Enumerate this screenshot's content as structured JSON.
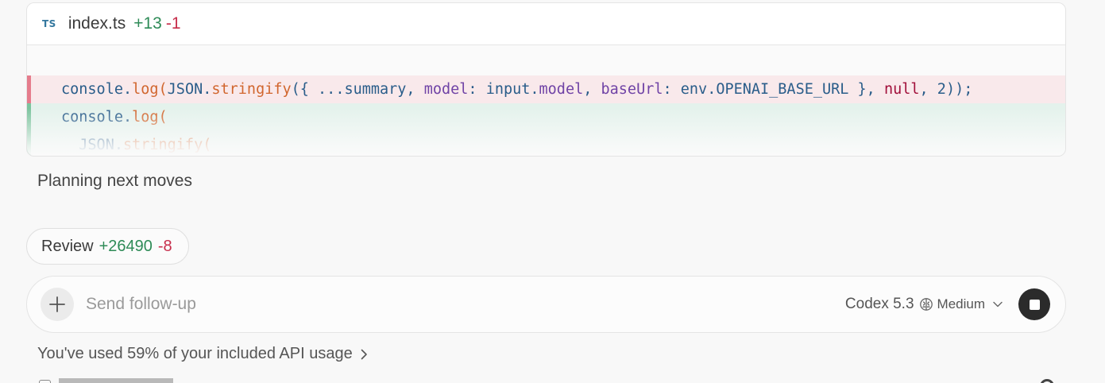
{
  "diff": {
    "file_badge": "TS",
    "file_name": "index.ts",
    "additions": "+13",
    "deletions": "-1",
    "lines": [
      {
        "kind": "removed",
        "tokens": [
          {
            "t": "console",
            "c": "tok-id"
          },
          {
            "t": ".",
            "c": "tok-punct"
          },
          {
            "t": "log",
            "c": "tok-fn"
          },
          {
            "t": "(",
            "c": "tok-fn"
          },
          {
            "t": "JSON",
            "c": "tok-id"
          },
          {
            "t": ".",
            "c": "tok-punct"
          },
          {
            "t": "stringify",
            "c": "tok-fn"
          },
          {
            "t": "({ ...",
            "c": "tok-punct"
          },
          {
            "t": "summary",
            "c": "tok-id"
          },
          {
            "t": ", ",
            "c": "tok-punct"
          },
          {
            "t": "model",
            "c": "tok-prop"
          },
          {
            "t": ": ",
            "c": "tok-punct"
          },
          {
            "t": "input",
            "c": "tok-id"
          },
          {
            "t": ".",
            "c": "tok-punct"
          },
          {
            "t": "model",
            "c": "tok-prop"
          },
          {
            "t": ", ",
            "c": "tok-punct"
          },
          {
            "t": "baseUrl",
            "c": "tok-prop"
          },
          {
            "t": ": ",
            "c": "tok-punct"
          },
          {
            "t": "env",
            "c": "tok-id"
          },
          {
            "t": ".",
            "c": "tok-punct"
          },
          {
            "t": "OPENAI_BASE_URL",
            "c": "tok-id"
          },
          {
            "t": " }, ",
            "c": "tok-punct"
          },
          {
            "t": "null",
            "c": "tok-kw"
          },
          {
            "t": ", 2));",
            "c": "tok-punct"
          }
        ]
      },
      {
        "kind": "added",
        "tokens": [
          {
            "t": "console",
            "c": "tok-id"
          },
          {
            "t": ".",
            "c": "tok-punct"
          },
          {
            "t": "log",
            "c": "tok-fn"
          },
          {
            "t": "(",
            "c": "tok-fn"
          }
        ]
      },
      {
        "kind": "added",
        "tokens": [
          {
            "t": "  JSON",
            "c": "tok-id"
          },
          {
            "t": ".",
            "c": "tok-punct"
          },
          {
            "t": "stringify",
            "c": "tok-fn"
          },
          {
            "t": "(",
            "c": "tok-fn"
          }
        ]
      }
    ]
  },
  "status": "Planning next moves",
  "review": {
    "label": "Review",
    "additions": "+26490",
    "deletions": "-8"
  },
  "composer": {
    "placeholder": "Send follow-up",
    "model": "Codex 5.3",
    "effort": "Medium"
  },
  "usage": {
    "text": "You've used 59% of your included API usage"
  },
  "icons": {
    "add": "plus-icon",
    "effort": "brain-icon",
    "dropdown": "chevron-down-icon",
    "stop": "stop-icon",
    "usage_link": "chevron-right-icon"
  },
  "colors": {
    "added": "#2e8b57",
    "removed": "#c72e4b",
    "accent_dark": "#2b2b2b"
  }
}
